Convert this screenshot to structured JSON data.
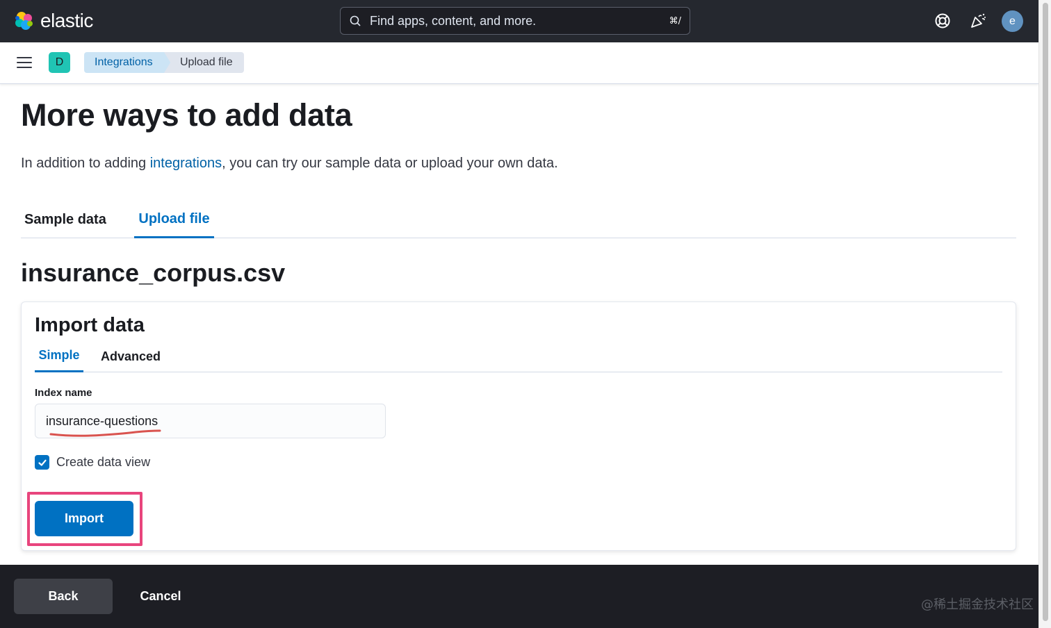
{
  "header": {
    "brand": "elastic",
    "search_placeholder": "Find apps, content, and more.",
    "search_shortcut": "⌘/",
    "avatar_initial": "e"
  },
  "subnav": {
    "space_initial": "D",
    "breadcrumbs": [
      "Integrations",
      "Upload file"
    ]
  },
  "page": {
    "title": "More ways to add data",
    "intro_before": "In addition to adding ",
    "intro_link": "integrations",
    "intro_after": ", you can try our sample data or upload your own data.",
    "tabs": [
      "Sample data",
      "Upload file"
    ],
    "active_tab": "Upload file",
    "file_name": "insurance_corpus.csv"
  },
  "import_panel": {
    "title": "Import data",
    "tabs": [
      "Simple",
      "Advanced"
    ],
    "active_tab": "Simple",
    "index_label": "Index name",
    "index_value": "insurance-questions",
    "create_data_view_label": "Create data view",
    "create_data_view_checked": true,
    "import_label": "Import"
  },
  "footer": {
    "back_label": "Back",
    "cancel_label": "Cancel"
  },
  "watermark": "@稀土掘金技术社区",
  "colors": {
    "accent": "#0071c2",
    "header_bg": "#25282f",
    "highlight": "#e8457d",
    "annotation": "#d9534f"
  }
}
